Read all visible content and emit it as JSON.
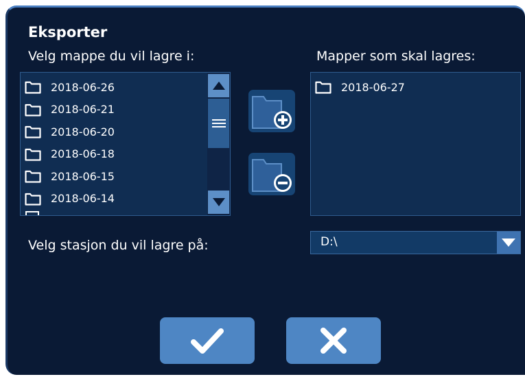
{
  "dialog": {
    "title": "Eksporter",
    "source_label": "Velg mappe du vil lagre i:",
    "target_label": "Mapper som skal lagres:",
    "drive_label": "Velg stasjon du vil lagre på:"
  },
  "source_folders": [
    "2018-06-26",
    "2018-06-21",
    "2018-06-20",
    "2018-06-18",
    "2018-06-15",
    "2018-06-14"
  ],
  "target_folders": [
    "2018-06-27"
  ],
  "drive": {
    "selected": "D:\\"
  },
  "icons": {
    "folder": "folder-icon",
    "add_folder": "folder-add-icon",
    "remove_folder": "folder-remove-icon",
    "scroll_up": "arrow-up-icon",
    "scroll_down": "arrow-down-icon",
    "scroll_thumb": "menu-icon",
    "dropdown": "chevron-down-icon",
    "confirm": "checkmark-icon",
    "cancel": "close-icon"
  },
  "colors": {
    "background": "#0a1a35",
    "list_background": "#102d52",
    "button": "#4e86c4",
    "accent": "#5d8fc7"
  }
}
